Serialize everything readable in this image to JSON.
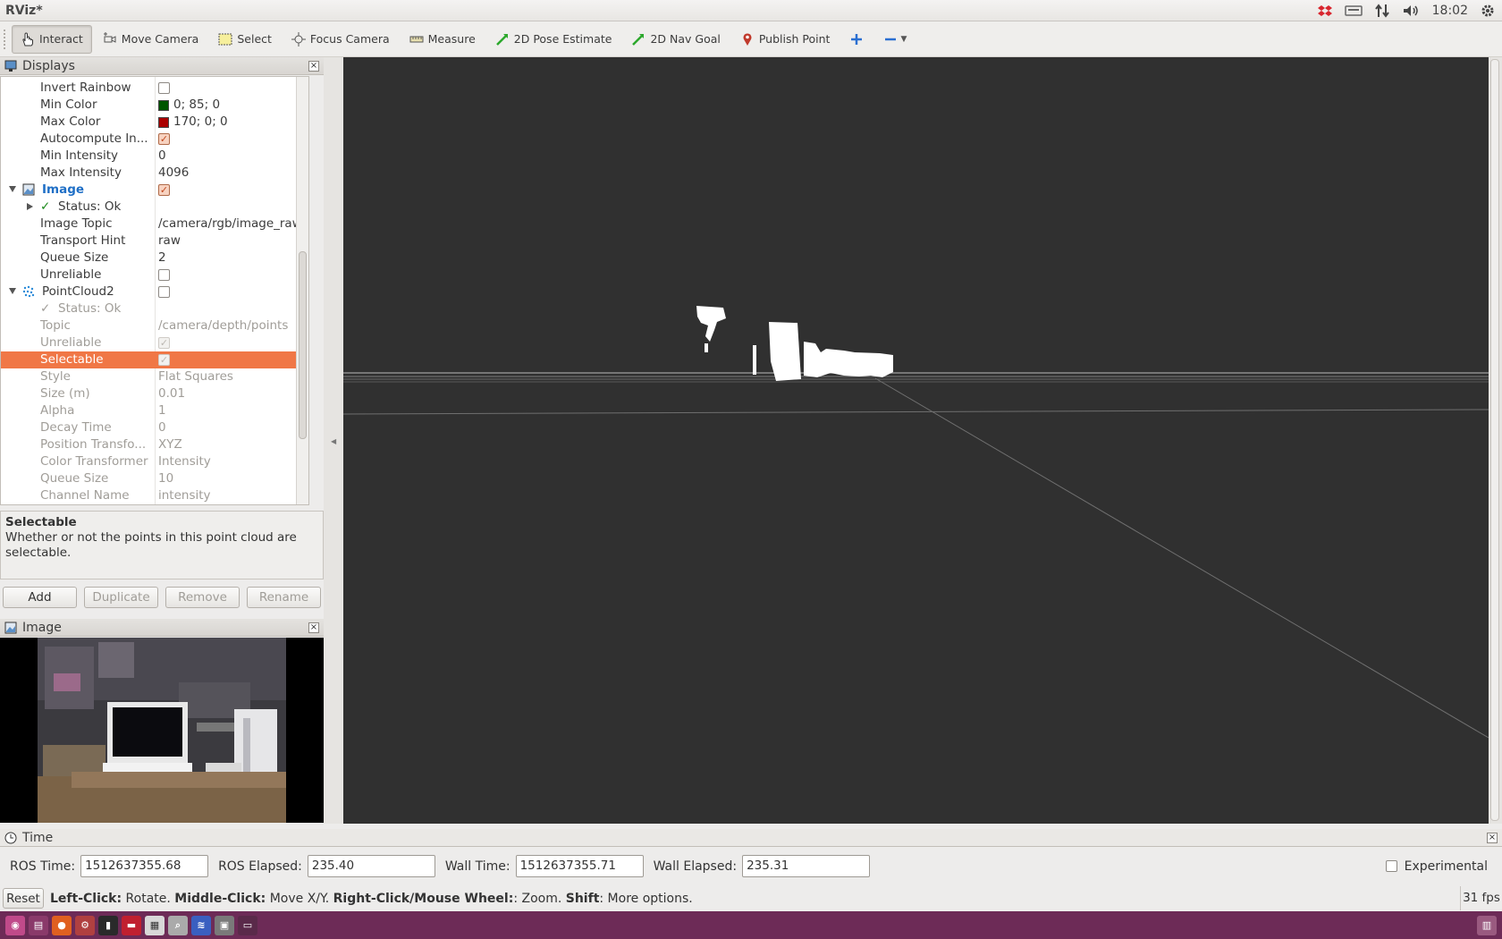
{
  "app": {
    "title": "RViz*"
  },
  "tray": {
    "clock": "18:02"
  },
  "toolbar": {
    "tools": [
      {
        "label": "Interact",
        "icon": "hand-icon",
        "active": true
      },
      {
        "label": "Move Camera",
        "icon": "move-camera-icon"
      },
      {
        "label": "Select",
        "icon": "select-icon"
      },
      {
        "label": "Focus Camera",
        "icon": "focus-camera-icon"
      },
      {
        "label": "Measure",
        "icon": "ruler-icon"
      },
      {
        "label": "2D Pose Estimate",
        "icon": "pose-arrow-icon"
      },
      {
        "label": "2D Nav Goal",
        "icon": "nav-arrow-icon"
      },
      {
        "label": "Publish Point",
        "icon": "map-pin-icon"
      }
    ]
  },
  "displays": {
    "title": "Displays",
    "rows": [
      {
        "name": "Invert Rainbow",
        "value": "",
        "check": "off"
      },
      {
        "name": "Min Color",
        "value": "0; 85; 0",
        "swatch": "#005500"
      },
      {
        "name": "Max Color",
        "value": "170; 0; 0",
        "swatch": "#aa0000"
      },
      {
        "name": "Autocompute In...",
        "value": "",
        "check": "on"
      },
      {
        "name": "Min Intensity",
        "value": "0"
      },
      {
        "name": "Max Intensity",
        "value": "4096"
      },
      {
        "name": "Image",
        "value": "",
        "check": "on",
        "group": true,
        "blue": true
      },
      {
        "name": "Status: Ok",
        "value": "",
        "status": true
      },
      {
        "name": "Image Topic",
        "value": "/camera/rgb/image_raw"
      },
      {
        "name": "Transport Hint",
        "value": "raw"
      },
      {
        "name": "Queue Size",
        "value": "2"
      },
      {
        "name": "Unreliable",
        "value": "",
        "check": "off"
      },
      {
        "name": "PointCloud2",
        "value": "",
        "check": "off",
        "group": true
      },
      {
        "name": "Status: Ok",
        "value": "",
        "status": true,
        "dim": true
      },
      {
        "name": "Topic",
        "value": "/camera/depth/points",
        "dim": true
      },
      {
        "name": "Unreliable",
        "value": "",
        "check": "dim",
        "dim": true
      },
      {
        "name": "Selectable",
        "value": "",
        "check": "dim",
        "selected": true
      },
      {
        "name": "Style",
        "value": "Flat Squares",
        "dim": true
      },
      {
        "name": "Size (m)",
        "value": "0.01",
        "dim": true
      },
      {
        "name": "Alpha",
        "value": "1",
        "dim": true
      },
      {
        "name": "Decay Time",
        "value": "0",
        "dim": true
      },
      {
        "name": "Position Transfo...",
        "value": "XYZ",
        "dim": true
      },
      {
        "name": "Color Transformer",
        "value": "Intensity",
        "dim": true
      },
      {
        "name": "Queue Size",
        "value": "10",
        "dim": true
      },
      {
        "name": "Channel Name",
        "value": "intensity",
        "dim": true
      }
    ]
  },
  "description": {
    "title": "Selectable",
    "text": "Whether or not the points in this point cloud are selectable."
  },
  "buttons": {
    "add": "Add",
    "duplicate": "Duplicate",
    "remove": "Remove",
    "rename": "Rename"
  },
  "image_panel": {
    "title": "Image"
  },
  "time_panel": {
    "title": "Time",
    "ros_time_label": "ROS Time:",
    "ros_time": "1512637355.68",
    "ros_elapsed_label": "ROS Elapsed:",
    "ros_elapsed": "235.40",
    "wall_time_label": "Wall Time:",
    "wall_time": "1512637355.71",
    "wall_elapsed_label": "Wall Elapsed:",
    "wall_elapsed": "235.31",
    "experimental_label": "Experimental"
  },
  "status": {
    "reset": "Reset",
    "left_click": "Left-Click:",
    "left_click_text": " Rotate. ",
    "middle_click": "Middle-Click:",
    "middle_click_text": " Move X/Y. ",
    "right_click": "Right-Click/Mouse Wheel:",
    "right_click_text": ": Zoom. ",
    "shift": "Shift",
    "shift_text": ": More options.",
    "fps": "31 fps"
  }
}
